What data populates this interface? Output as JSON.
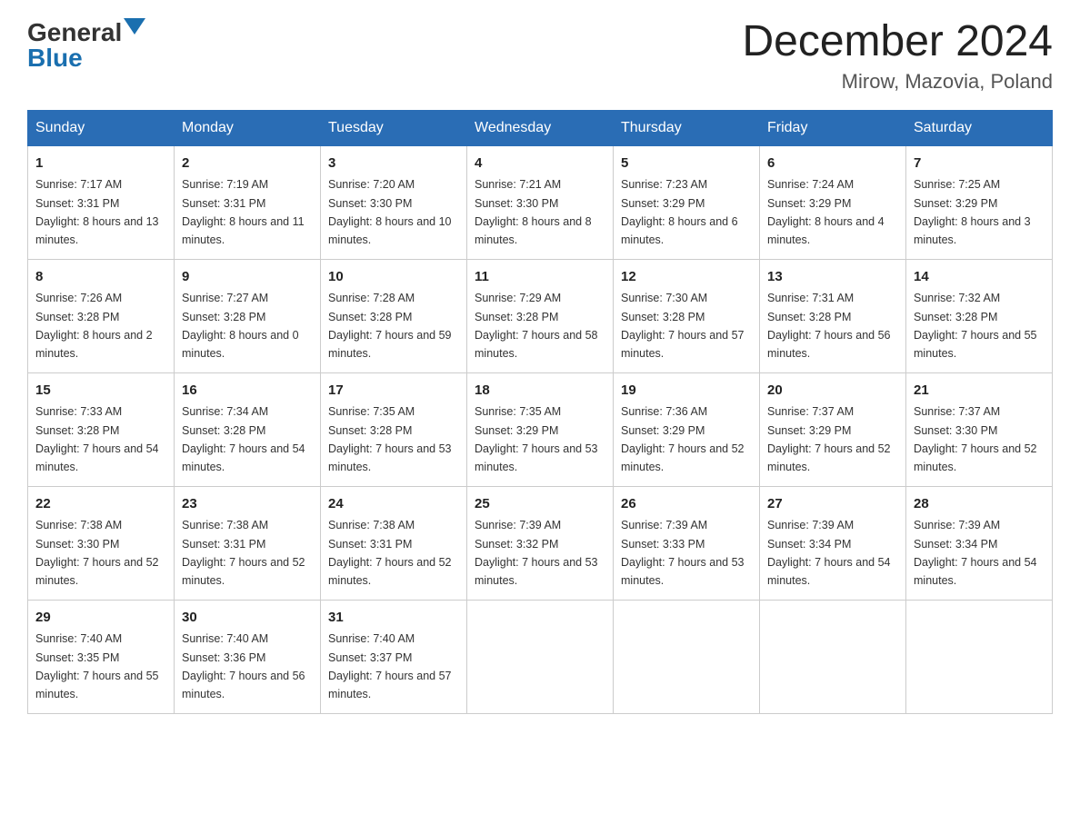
{
  "header": {
    "logo_general": "General",
    "logo_blue": "Blue",
    "title": "December 2024",
    "subtitle": "Mirow, Mazovia, Poland"
  },
  "columns": [
    "Sunday",
    "Monday",
    "Tuesday",
    "Wednesday",
    "Thursday",
    "Friday",
    "Saturday"
  ],
  "weeks": [
    [
      {
        "day": "1",
        "sunrise": "Sunrise: 7:17 AM",
        "sunset": "Sunset: 3:31 PM",
        "daylight": "Daylight: 8 hours and 13 minutes."
      },
      {
        "day": "2",
        "sunrise": "Sunrise: 7:19 AM",
        "sunset": "Sunset: 3:31 PM",
        "daylight": "Daylight: 8 hours and 11 minutes."
      },
      {
        "day": "3",
        "sunrise": "Sunrise: 7:20 AM",
        "sunset": "Sunset: 3:30 PM",
        "daylight": "Daylight: 8 hours and 10 minutes."
      },
      {
        "day": "4",
        "sunrise": "Sunrise: 7:21 AM",
        "sunset": "Sunset: 3:30 PM",
        "daylight": "Daylight: 8 hours and 8 minutes."
      },
      {
        "day": "5",
        "sunrise": "Sunrise: 7:23 AM",
        "sunset": "Sunset: 3:29 PM",
        "daylight": "Daylight: 8 hours and 6 minutes."
      },
      {
        "day": "6",
        "sunrise": "Sunrise: 7:24 AM",
        "sunset": "Sunset: 3:29 PM",
        "daylight": "Daylight: 8 hours and 4 minutes."
      },
      {
        "day": "7",
        "sunrise": "Sunrise: 7:25 AM",
        "sunset": "Sunset: 3:29 PM",
        "daylight": "Daylight: 8 hours and 3 minutes."
      }
    ],
    [
      {
        "day": "8",
        "sunrise": "Sunrise: 7:26 AM",
        "sunset": "Sunset: 3:28 PM",
        "daylight": "Daylight: 8 hours and 2 minutes."
      },
      {
        "day": "9",
        "sunrise": "Sunrise: 7:27 AM",
        "sunset": "Sunset: 3:28 PM",
        "daylight": "Daylight: 8 hours and 0 minutes."
      },
      {
        "day": "10",
        "sunrise": "Sunrise: 7:28 AM",
        "sunset": "Sunset: 3:28 PM",
        "daylight": "Daylight: 7 hours and 59 minutes."
      },
      {
        "day": "11",
        "sunrise": "Sunrise: 7:29 AM",
        "sunset": "Sunset: 3:28 PM",
        "daylight": "Daylight: 7 hours and 58 minutes."
      },
      {
        "day": "12",
        "sunrise": "Sunrise: 7:30 AM",
        "sunset": "Sunset: 3:28 PM",
        "daylight": "Daylight: 7 hours and 57 minutes."
      },
      {
        "day": "13",
        "sunrise": "Sunrise: 7:31 AM",
        "sunset": "Sunset: 3:28 PM",
        "daylight": "Daylight: 7 hours and 56 minutes."
      },
      {
        "day": "14",
        "sunrise": "Sunrise: 7:32 AM",
        "sunset": "Sunset: 3:28 PM",
        "daylight": "Daylight: 7 hours and 55 minutes."
      }
    ],
    [
      {
        "day": "15",
        "sunrise": "Sunrise: 7:33 AM",
        "sunset": "Sunset: 3:28 PM",
        "daylight": "Daylight: 7 hours and 54 minutes."
      },
      {
        "day": "16",
        "sunrise": "Sunrise: 7:34 AM",
        "sunset": "Sunset: 3:28 PM",
        "daylight": "Daylight: 7 hours and 54 minutes."
      },
      {
        "day": "17",
        "sunrise": "Sunrise: 7:35 AM",
        "sunset": "Sunset: 3:28 PM",
        "daylight": "Daylight: 7 hours and 53 minutes."
      },
      {
        "day": "18",
        "sunrise": "Sunrise: 7:35 AM",
        "sunset": "Sunset: 3:29 PM",
        "daylight": "Daylight: 7 hours and 53 minutes."
      },
      {
        "day": "19",
        "sunrise": "Sunrise: 7:36 AM",
        "sunset": "Sunset: 3:29 PM",
        "daylight": "Daylight: 7 hours and 52 minutes."
      },
      {
        "day": "20",
        "sunrise": "Sunrise: 7:37 AM",
        "sunset": "Sunset: 3:29 PM",
        "daylight": "Daylight: 7 hours and 52 minutes."
      },
      {
        "day": "21",
        "sunrise": "Sunrise: 7:37 AM",
        "sunset": "Sunset: 3:30 PM",
        "daylight": "Daylight: 7 hours and 52 minutes."
      }
    ],
    [
      {
        "day": "22",
        "sunrise": "Sunrise: 7:38 AM",
        "sunset": "Sunset: 3:30 PM",
        "daylight": "Daylight: 7 hours and 52 minutes."
      },
      {
        "day": "23",
        "sunrise": "Sunrise: 7:38 AM",
        "sunset": "Sunset: 3:31 PM",
        "daylight": "Daylight: 7 hours and 52 minutes."
      },
      {
        "day": "24",
        "sunrise": "Sunrise: 7:38 AM",
        "sunset": "Sunset: 3:31 PM",
        "daylight": "Daylight: 7 hours and 52 minutes."
      },
      {
        "day": "25",
        "sunrise": "Sunrise: 7:39 AM",
        "sunset": "Sunset: 3:32 PM",
        "daylight": "Daylight: 7 hours and 53 minutes."
      },
      {
        "day": "26",
        "sunrise": "Sunrise: 7:39 AM",
        "sunset": "Sunset: 3:33 PM",
        "daylight": "Daylight: 7 hours and 53 minutes."
      },
      {
        "day": "27",
        "sunrise": "Sunrise: 7:39 AM",
        "sunset": "Sunset: 3:34 PM",
        "daylight": "Daylight: 7 hours and 54 minutes."
      },
      {
        "day": "28",
        "sunrise": "Sunrise: 7:39 AM",
        "sunset": "Sunset: 3:34 PM",
        "daylight": "Daylight: 7 hours and 54 minutes."
      }
    ],
    [
      {
        "day": "29",
        "sunrise": "Sunrise: 7:40 AM",
        "sunset": "Sunset: 3:35 PM",
        "daylight": "Daylight: 7 hours and 55 minutes."
      },
      {
        "day": "30",
        "sunrise": "Sunrise: 7:40 AM",
        "sunset": "Sunset: 3:36 PM",
        "daylight": "Daylight: 7 hours and 56 minutes."
      },
      {
        "day": "31",
        "sunrise": "Sunrise: 7:40 AM",
        "sunset": "Sunset: 3:37 PM",
        "daylight": "Daylight: 7 hours and 57 minutes."
      },
      {
        "day": "",
        "sunrise": "",
        "sunset": "",
        "daylight": ""
      },
      {
        "day": "",
        "sunrise": "",
        "sunset": "",
        "daylight": ""
      },
      {
        "day": "",
        "sunrise": "",
        "sunset": "",
        "daylight": ""
      },
      {
        "day": "",
        "sunrise": "",
        "sunset": "",
        "daylight": ""
      }
    ]
  ]
}
